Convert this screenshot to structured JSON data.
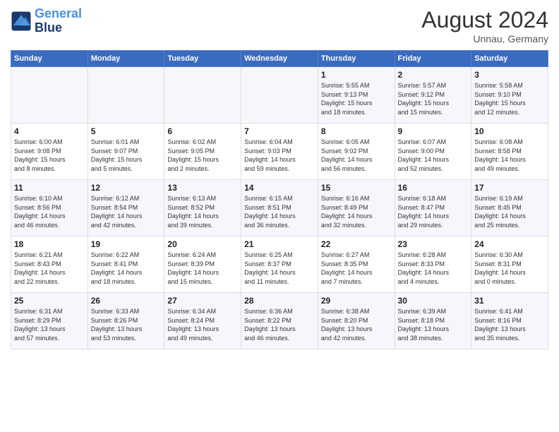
{
  "header": {
    "logo_line1": "General",
    "logo_line2": "Blue",
    "month_year": "August 2024",
    "location": "Unnau, Germany"
  },
  "weekdays": [
    "Sunday",
    "Monday",
    "Tuesday",
    "Wednesday",
    "Thursday",
    "Friday",
    "Saturday"
  ],
  "weeks": [
    [
      {
        "day": "",
        "info": ""
      },
      {
        "day": "",
        "info": ""
      },
      {
        "day": "",
        "info": ""
      },
      {
        "day": "",
        "info": ""
      },
      {
        "day": "1",
        "info": "Sunrise: 5:55 AM\nSunset: 9:13 PM\nDaylight: 15 hours\nand 18 minutes."
      },
      {
        "day": "2",
        "info": "Sunrise: 5:57 AM\nSunset: 9:12 PM\nDaylight: 15 hours\nand 15 minutes."
      },
      {
        "day": "3",
        "info": "Sunrise: 5:58 AM\nSunset: 9:10 PM\nDaylight: 15 hours\nand 12 minutes."
      }
    ],
    [
      {
        "day": "4",
        "info": "Sunrise: 6:00 AM\nSunset: 9:08 PM\nDaylight: 15 hours\nand 8 minutes."
      },
      {
        "day": "5",
        "info": "Sunrise: 6:01 AM\nSunset: 9:07 PM\nDaylight: 15 hours\nand 5 minutes."
      },
      {
        "day": "6",
        "info": "Sunrise: 6:02 AM\nSunset: 9:05 PM\nDaylight: 15 hours\nand 2 minutes."
      },
      {
        "day": "7",
        "info": "Sunrise: 6:04 AM\nSunset: 9:03 PM\nDaylight: 14 hours\nand 59 minutes."
      },
      {
        "day": "8",
        "info": "Sunrise: 6:05 AM\nSunset: 9:02 PM\nDaylight: 14 hours\nand 56 minutes."
      },
      {
        "day": "9",
        "info": "Sunrise: 6:07 AM\nSunset: 9:00 PM\nDaylight: 14 hours\nand 52 minutes."
      },
      {
        "day": "10",
        "info": "Sunrise: 6:08 AM\nSunset: 8:58 PM\nDaylight: 14 hours\nand 49 minutes."
      }
    ],
    [
      {
        "day": "11",
        "info": "Sunrise: 6:10 AM\nSunset: 8:56 PM\nDaylight: 14 hours\nand 46 minutes."
      },
      {
        "day": "12",
        "info": "Sunrise: 6:12 AM\nSunset: 8:54 PM\nDaylight: 14 hours\nand 42 minutes."
      },
      {
        "day": "13",
        "info": "Sunrise: 6:13 AM\nSunset: 8:52 PM\nDaylight: 14 hours\nand 39 minutes."
      },
      {
        "day": "14",
        "info": "Sunrise: 6:15 AM\nSunset: 8:51 PM\nDaylight: 14 hours\nand 36 minutes."
      },
      {
        "day": "15",
        "info": "Sunrise: 6:16 AM\nSunset: 8:49 PM\nDaylight: 14 hours\nand 32 minutes."
      },
      {
        "day": "16",
        "info": "Sunrise: 6:18 AM\nSunset: 8:47 PM\nDaylight: 14 hours\nand 29 minutes."
      },
      {
        "day": "17",
        "info": "Sunrise: 6:19 AM\nSunset: 8:45 PM\nDaylight: 14 hours\nand 25 minutes."
      }
    ],
    [
      {
        "day": "18",
        "info": "Sunrise: 6:21 AM\nSunset: 8:43 PM\nDaylight: 14 hours\nand 22 minutes."
      },
      {
        "day": "19",
        "info": "Sunrise: 6:22 AM\nSunset: 8:41 PM\nDaylight: 14 hours\nand 18 minutes."
      },
      {
        "day": "20",
        "info": "Sunrise: 6:24 AM\nSunset: 8:39 PM\nDaylight: 14 hours\nand 15 minutes."
      },
      {
        "day": "21",
        "info": "Sunrise: 6:25 AM\nSunset: 8:37 PM\nDaylight: 14 hours\nand 11 minutes."
      },
      {
        "day": "22",
        "info": "Sunrise: 6:27 AM\nSunset: 8:35 PM\nDaylight: 14 hours\nand 7 minutes."
      },
      {
        "day": "23",
        "info": "Sunrise: 6:28 AM\nSunset: 8:33 PM\nDaylight: 14 hours\nand 4 minutes."
      },
      {
        "day": "24",
        "info": "Sunrise: 6:30 AM\nSunset: 8:31 PM\nDaylight: 14 hours\nand 0 minutes."
      }
    ],
    [
      {
        "day": "25",
        "info": "Sunrise: 6:31 AM\nSunset: 8:29 PM\nDaylight: 13 hours\nand 57 minutes."
      },
      {
        "day": "26",
        "info": "Sunrise: 6:33 AM\nSunset: 8:26 PM\nDaylight: 13 hours\nand 53 minutes."
      },
      {
        "day": "27",
        "info": "Sunrise: 6:34 AM\nSunset: 8:24 PM\nDaylight: 13 hours\nand 49 minutes."
      },
      {
        "day": "28",
        "info": "Sunrise: 6:36 AM\nSunset: 8:22 PM\nDaylight: 13 hours\nand 46 minutes."
      },
      {
        "day": "29",
        "info": "Sunrise: 6:38 AM\nSunset: 8:20 PM\nDaylight: 13 hours\nand 42 minutes."
      },
      {
        "day": "30",
        "info": "Sunrise: 6:39 AM\nSunset: 8:18 PM\nDaylight: 13 hours\nand 38 minutes."
      },
      {
        "day": "31",
        "info": "Sunrise: 6:41 AM\nSunset: 8:16 PM\nDaylight: 13 hours\nand 35 minutes."
      }
    ]
  ]
}
